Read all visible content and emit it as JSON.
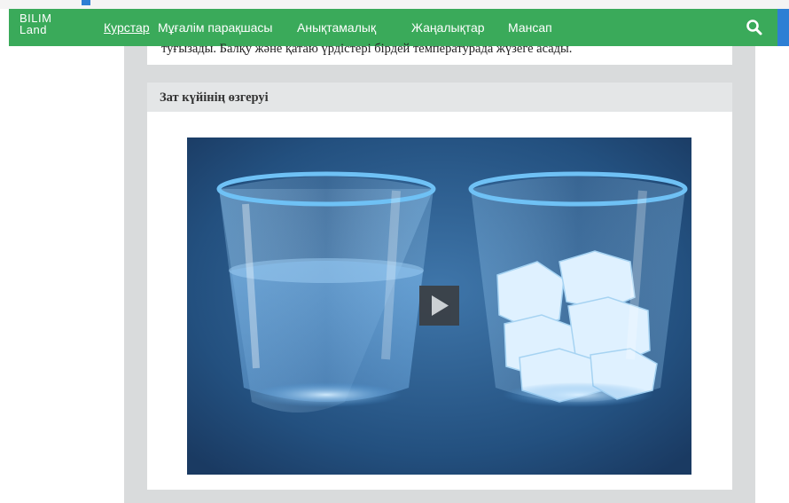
{
  "nav": {
    "logo_line1": "BILIM",
    "logo_line2": "Land",
    "links": [
      "Курстар",
      "Мұғалім парақшасы",
      "Анықтамалық",
      "Жаңалықтар",
      "Мансап"
    ],
    "search_icon": "search-icon"
  },
  "content": {
    "top_text": "туғызады. Балқу және қатаю үрдістері бірдей температурада жүзеге асады.",
    "section_title": "Зат күйінің өзгеруі",
    "video": {
      "description_icon": "play-icon"
    }
  },
  "colors": {
    "nav_green": "#3aaa5a",
    "nav_accent_blue": "#2e7fd4",
    "panel_gray": "#d9dbdc",
    "header_gray": "#e4e6e7"
  }
}
